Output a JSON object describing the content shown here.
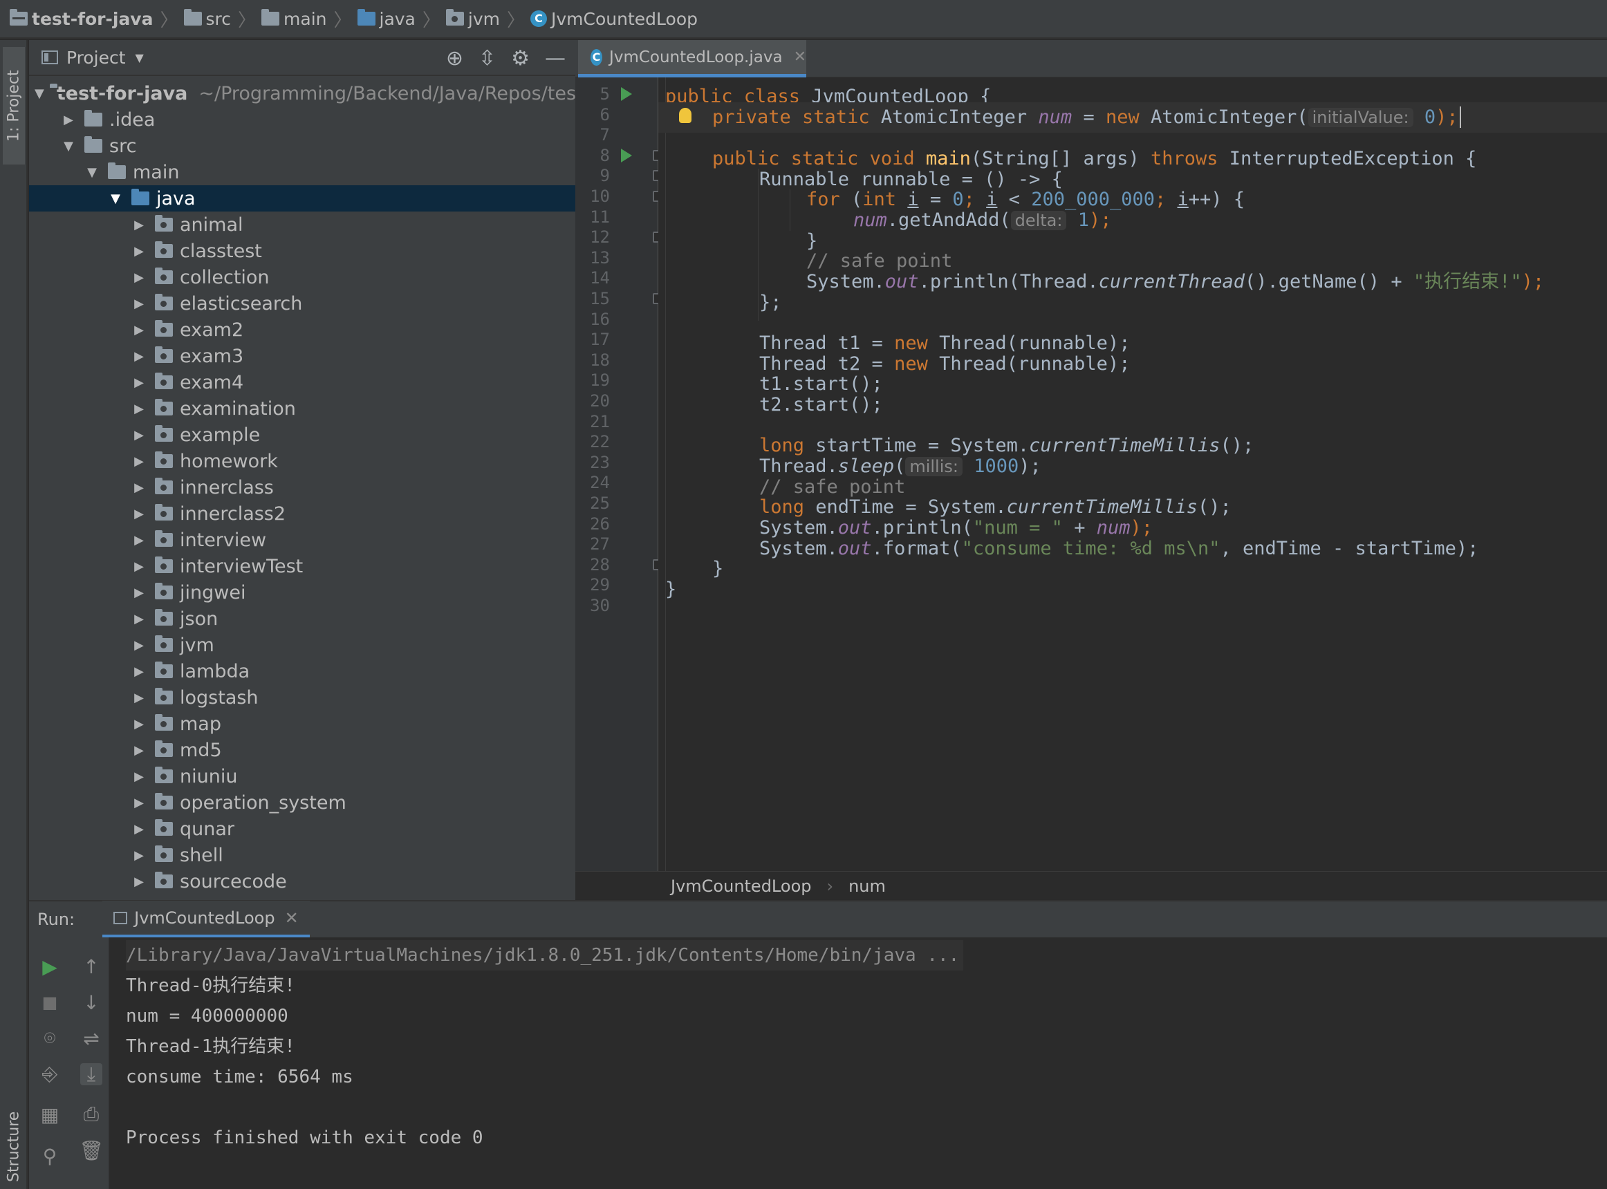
{
  "breadcrumbs": [
    "test-for-java",
    "src",
    "main",
    "java",
    "jvm",
    "JvmCountedLoop"
  ],
  "left_stripe": {
    "project_tab": "1: Project",
    "structure_tab": "Structure"
  },
  "project_panel": {
    "title": "Project",
    "root": {
      "name": "test-for-java",
      "path": "~/Programming/Backend/Java/Repos/tes"
    },
    "items": [
      {
        "label": ".idea",
        "expanded": false
      },
      {
        "label": "src",
        "expanded": true
      },
      {
        "label": "main",
        "expanded": true
      },
      {
        "label": "java",
        "expanded": true,
        "selected": true
      },
      {
        "label": "animal"
      },
      {
        "label": "classtest"
      },
      {
        "label": "collection"
      },
      {
        "label": "elasticsearch"
      },
      {
        "label": "exam2"
      },
      {
        "label": "exam3"
      },
      {
        "label": "exam4"
      },
      {
        "label": "examination"
      },
      {
        "label": "example"
      },
      {
        "label": "homework"
      },
      {
        "label": "innerclass"
      },
      {
        "label": "innerclass2"
      },
      {
        "label": "interview"
      },
      {
        "label": "interviewTest"
      },
      {
        "label": "jingwei"
      },
      {
        "label": "json"
      },
      {
        "label": "jvm"
      },
      {
        "label": "lambda"
      },
      {
        "label": "logstash"
      },
      {
        "label": "map"
      },
      {
        "label": "md5"
      },
      {
        "label": "niuniu"
      },
      {
        "label": "operation_system"
      },
      {
        "label": "qunar"
      },
      {
        "label": "shell"
      },
      {
        "label": "sourcecode"
      }
    ]
  },
  "editor": {
    "tab_label": "JvmCountedLoop.java",
    "line_numbers": [
      "5",
      "6",
      "7",
      "8",
      "9",
      "10",
      "11",
      "12",
      "13",
      "14",
      "15",
      "16",
      "17",
      "18",
      "19",
      "20",
      "21",
      "22",
      "23",
      "24",
      "25",
      "26",
      "27",
      "28",
      "29",
      "30"
    ],
    "code": {
      "l5_kw": "public class ",
      "l5_rest": "JvmCountedLoop {",
      "l6_kw": "private static ",
      "l6_type": "AtomicInteger ",
      "l6_fld": "num",
      "l6_eq": " = ",
      "l6_new": "new ",
      "l6_ctor": "AtomicInteger(",
      "l6_hint": "initialValue:",
      "l6_num": "0",
      "l6_end": ");",
      "l8_kw": "public static void ",
      "l8_mth": "main",
      "l8_mid": "(String[] args) ",
      "l8_throws": "throws ",
      "l8_rest": "InterruptedException {",
      "l9": "Runnable runnable = () -> {",
      "l10_for": "for ",
      "l10_a": "(",
      "l10_int": "int ",
      "l10_i": "i",
      "l10_b": " = ",
      "l10_zero": "0",
      "l10_c": "; ",
      "l10_i2": "i",
      "l10_d": " < ",
      "l10_big": "200_000_000",
      "l10_e": "; ",
      "l10_i3": "i",
      "l10_f": "++) {",
      "l11_fld": "num",
      "l11_call": ".getAndAdd(",
      "l11_hint": "delta:",
      "l11_num": "1",
      "l11_end": ");",
      "l12": "}",
      "l13": "// safe point",
      "l14_a": "System.",
      "l14_out": "out",
      "l14_b": ".println(Thread.",
      "l14_ct": "currentThread",
      "l14_c": "().getName() + ",
      "l14_str": "\"执行结束!\"",
      "l14_end": ");",
      "l15": "};",
      "l17_a": "Thread t1 = ",
      "l17_new": "new ",
      "l17_b": "Thread(runnable);",
      "l18_a": "Thread t2 = ",
      "l18_new": "new ",
      "l18_b": "Thread(runnable);",
      "l19": "t1.start();",
      "l20": "t2.start();",
      "l22_long": "long ",
      "l22_a": "startTime = System.",
      "l22_m": "currentTimeMillis",
      "l22_b": "();",
      "l23_a": "Thread.",
      "l23_m": "sleep",
      "l23_b": "(",
      "l23_hint": "millis:",
      "l23_num": "1000",
      "l23_c": ");",
      "l24": "// safe point",
      "l25_long": "long ",
      "l25_a": "endTime = System.",
      "l25_m": "currentTimeMillis",
      "l25_b": "();",
      "l26_a": "System.",
      "l26_out": "out",
      "l26_b": ".println(",
      "l26_str": "\"num = \"",
      "l26_c": " + ",
      "l26_fld": "num",
      "l26_d": ");",
      "l27_a": "System.",
      "l27_out": "out",
      "l27_b": ".format(",
      "l27_str": "\"consume time: %d ms\\n\"",
      "l27_c": ", endTime - startTime);",
      "l28": "}",
      "l29": "}"
    },
    "breadcrumb": [
      "JvmCountedLoop",
      "num"
    ]
  },
  "run_panel": {
    "label": "Run:",
    "tab_label": "JvmCountedLoop",
    "console": [
      "/Library/Java/JavaVirtualMachines/jdk1.8.0_251.jdk/Contents/Home/bin/java ...",
      "Thread-0执行结束!",
      "num = 400000000",
      "Thread-1执行结束!",
      "consume time: 6564 ms",
      "",
      "Process finished with exit code 0"
    ]
  },
  "colors": {
    "keyword": "#cc7832",
    "field": "#9876aa",
    "number": "#6897bb",
    "string": "#6a8759",
    "comment": "#808080",
    "method": "#ffc66d",
    "selection": "#0d293e",
    "accent": "#4a88c7",
    "run_green": "#499c54"
  }
}
